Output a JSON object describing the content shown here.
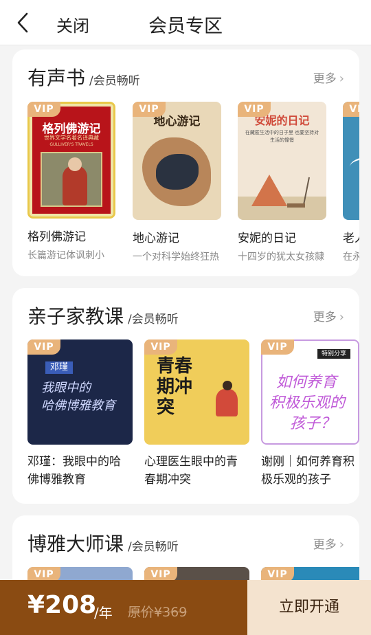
{
  "header": {
    "close_label": "关闭",
    "title": "会员专区"
  },
  "vip_badge": "VIP",
  "sections": [
    {
      "title": "有声书",
      "subtitle": "/会员畅听",
      "more_label": "更多",
      "items": [
        {
          "title": "格列佛游记",
          "subtitle": "长篇游记体讽刺小",
          "cover_text": "格列佛游记",
          "cover_caption": "世界文学名著名译典藏",
          "cover_sub": "GULLIVER'S TRAVELS"
        },
        {
          "title": "地心游记",
          "subtitle": "一个对科学始终狂热",
          "cover_text": "地心游记"
        },
        {
          "title": "安妮的日记",
          "subtitle": "十四岁的犹太女孩隸",
          "cover_text": "安妮的日记",
          "cover_caption": "在藏匿生活中的日子里 也要坚持对生活的憧憬"
        },
        {
          "title": "老人",
          "subtitle": "在永"
        }
      ]
    },
    {
      "title": "亲子家教课",
      "subtitle": "/会员畅听",
      "more_label": "更多",
      "items": [
        {
          "title": "邓瑾：我眼中的哈佛博雅教育",
          "cover_name": "邓瑾",
          "cover_text_1": "我眼中的",
          "cover_text_2": "哈佛博雅教育"
        },
        {
          "title": "心理医生眼中的青春期冲突",
          "cover_text": "青春期冲突"
        },
        {
          "title": "谢刚｜如何养育积极乐观的孩子",
          "cover_tag": "特别分享",
          "cover_text_1": "如何养育",
          "cover_text_2": "积极乐观的",
          "cover_text_3": "孩子？"
        }
      ]
    },
    {
      "title": "博雅大师课",
      "subtitle": "/会员畅听",
      "more_label": "更多"
    }
  ],
  "bottom": {
    "price": "¥208",
    "period": "/年",
    "original_price": "原价¥369",
    "open_label": "立即开通"
  }
}
